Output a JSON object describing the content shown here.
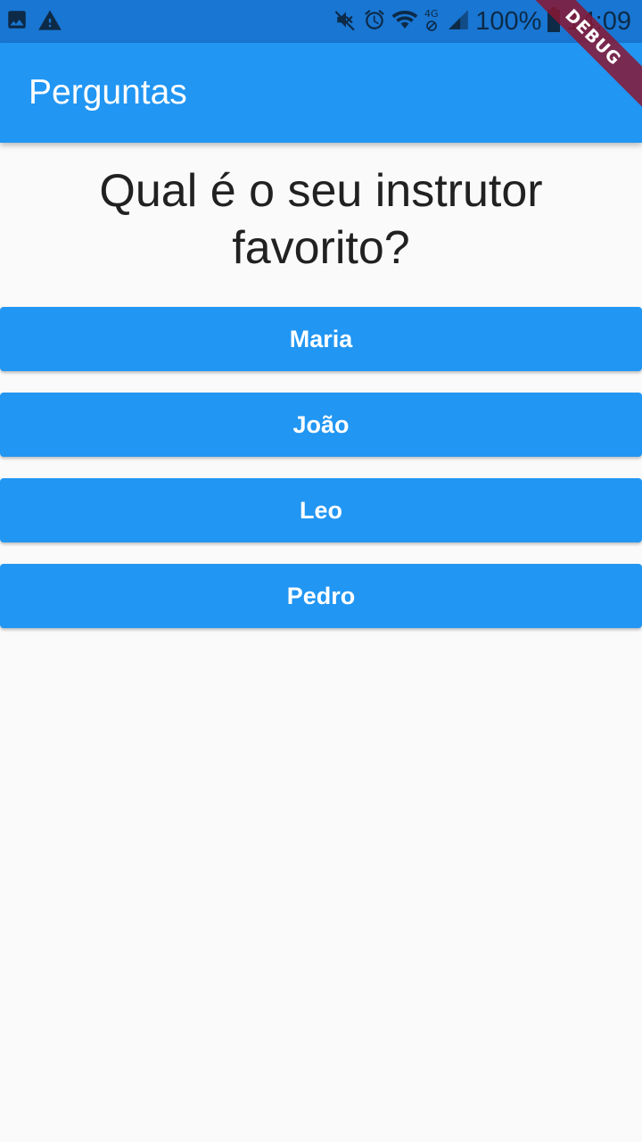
{
  "status_bar": {
    "battery_text": "100%",
    "time": "14:09",
    "icons": [
      "image-icon",
      "warning-icon",
      "mute-icon",
      "alarm-icon",
      "wifi-icon",
      "network-4g-icon",
      "signal-icon",
      "battery-icon"
    ]
  },
  "app_bar": {
    "title": "Perguntas"
  },
  "debug_banner": {
    "label": "DEBUG"
  },
  "question": {
    "text": "Qual é o seu instrutor favorito?"
  },
  "answers": [
    {
      "label": "Maria"
    },
    {
      "label": "João"
    },
    {
      "label": "Leo"
    },
    {
      "label": "Pedro"
    }
  ],
  "colors": {
    "primary": "#2196F3",
    "primary_dark": "#1976D2",
    "background": "#FAFAFA",
    "debug_banner": "#881834"
  }
}
